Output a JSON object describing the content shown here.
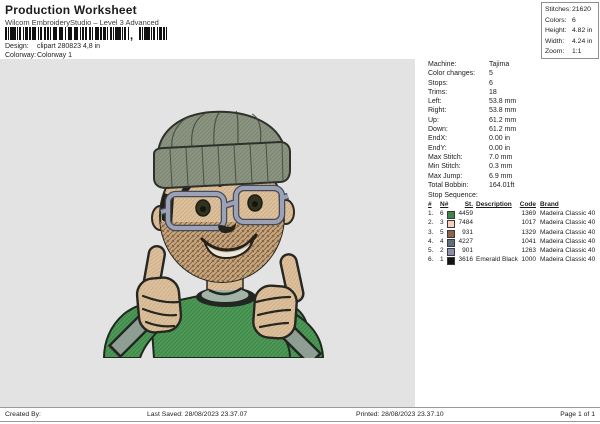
{
  "header": {
    "title": "Production Worksheet",
    "subtitle": "Wilcom EmbroideryStudio – Level 3 Advanced",
    "design_label": "Design:",
    "design_value": "clipart 280823 4,8 in",
    "colorway_label": "Colorway:",
    "colorway_value": "Colorway 1",
    "barcode_separator": ","
  },
  "stats": {
    "rows": [
      {
        "label": "Stitches:",
        "value": "21620"
      },
      {
        "label": "Colors:",
        "value": "6"
      },
      {
        "label": "Height:",
        "value": "4.82 in"
      },
      {
        "label": "Width:",
        "value": "4.24 in"
      },
      {
        "label": "Zoom:",
        "value": "1:1"
      }
    ]
  },
  "machine": {
    "rows": [
      {
        "label": "Machine:",
        "value": "Tajima"
      },
      {
        "label": "Color changes:",
        "value": "5"
      },
      {
        "label": "Stops:",
        "value": "6"
      },
      {
        "label": "Trims:",
        "value": "18"
      },
      {
        "label": "Left:",
        "value": "53.8 mm"
      },
      {
        "label": "Right:",
        "value": "53.8 mm"
      },
      {
        "label": "Up:",
        "value": "61.2 mm"
      },
      {
        "label": "Down:",
        "value": "61.2 mm"
      },
      {
        "label": "EndX:",
        "value": "0.00 in"
      },
      {
        "label": "EndY:",
        "value": "0.00 in"
      },
      {
        "label": "Max Stitch:",
        "value": "7.0 mm"
      },
      {
        "label": "Min Stitch:",
        "value": "0.3 mm"
      },
      {
        "label": "Max Jump:",
        "value": "6.9 mm"
      },
      {
        "label": "Total Bobbin:",
        "value": "164.01ft"
      }
    ]
  },
  "stop_sequence": {
    "title": "Stop Sequence:",
    "columns": {
      "seq": "#",
      "needle": "N#",
      "stitches": "St.",
      "description": "Description",
      "code": "Code",
      "brand": "Brand"
    },
    "rows": [
      {
        "seq": "1.",
        "needle": "6",
        "color": "#3f8449",
        "stitches": "4459",
        "description": "",
        "code": "1369",
        "brand": "Madeira Classic 40"
      },
      {
        "seq": "2.",
        "needle": "3",
        "color": "#f2d1c2",
        "stitches": "7484",
        "description": "",
        "code": "1017",
        "brand": "Madeira Classic 40"
      },
      {
        "seq": "3.",
        "needle": "5",
        "color": "#8a6351",
        "stitches": "931",
        "description": "",
        "code": "1329",
        "brand": "Madeira Classic 40"
      },
      {
        "seq": "4.",
        "needle": "4",
        "color": "#5f6e79",
        "stitches": "4227",
        "description": "",
        "code": "1041",
        "brand": "Madeira Classic 40"
      },
      {
        "seq": "5.",
        "needle": "2",
        "color": "#8b8dac",
        "stitches": "901",
        "description": "",
        "code": "1263",
        "brand": "Madeira Classic 40"
      },
      {
        "seq": "6.",
        "needle": "1",
        "color": "#141414",
        "stitches": "3616",
        "description": "Emerald Black",
        "code": "1000",
        "brand": "Madeira Classic 40"
      }
    ]
  },
  "footer": {
    "created_by": "Created By:",
    "last_saved": "Last Saved: 28/08/2023 23.37.07",
    "printed": "Printed: 28/08/2023 23.37.10",
    "page": "Page 1 of 1"
  }
}
